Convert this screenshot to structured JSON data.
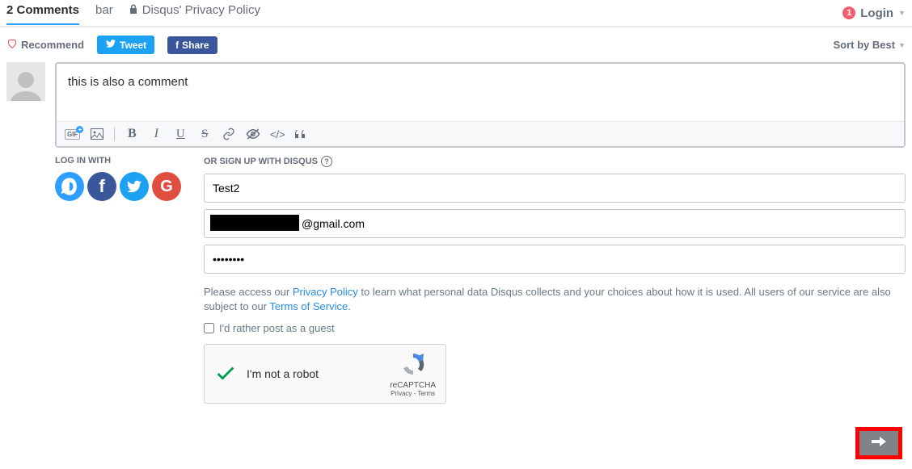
{
  "header": {
    "comments_tab": "2 Comments",
    "site_tab": "bar",
    "privacy_tab": "Disqus' Privacy Policy",
    "login_label": "Login",
    "badge_count": "1"
  },
  "actions": {
    "recommend": "Recommend",
    "tweet": "Tweet",
    "share": "Share",
    "sort": "Sort by Best"
  },
  "compose": {
    "text": "this is also a comment",
    "gif_label": "GIF"
  },
  "login_section": {
    "label": "LOG IN WITH"
  },
  "signup_section": {
    "label": "OR SIGN UP WITH DISQUS",
    "name_value": "Test2",
    "email_suffix": "@gmail.com",
    "password_value": "••••••••",
    "legal_prefix": "Please access our ",
    "legal_privacy": "Privacy Policy",
    "legal_mid": " to learn what personal data Disqus collects and your choices about how it is used. All users of our service are also subject to our ",
    "legal_tos": "Terms of Service",
    "legal_suffix": ".",
    "guest_label": "I'd rather post as a guest"
  },
  "recaptcha": {
    "text": "I'm not a robot",
    "brand": "reCAPTCHA",
    "links": "Privacy - Terms"
  }
}
